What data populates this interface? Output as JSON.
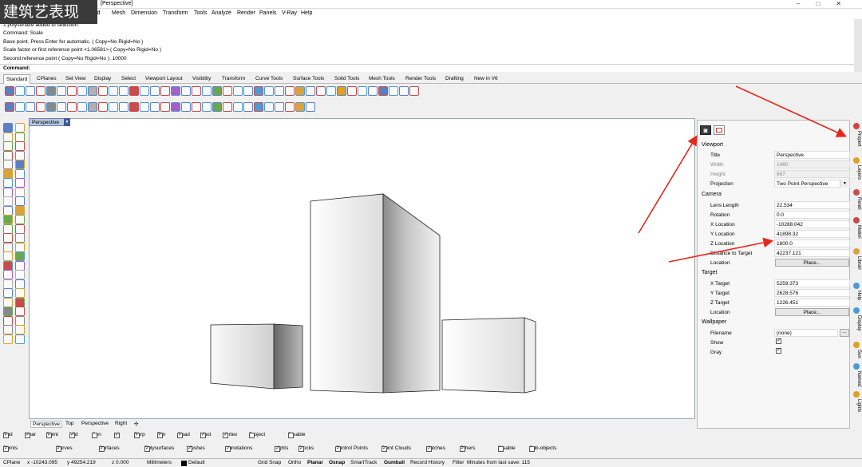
{
  "watermark": "建筑艺表现",
  "window": {
    "title": "[Perspective]"
  },
  "menu": [
    "id",
    "Mesh",
    "Dimension",
    "Transform",
    "Tools",
    "Analyze",
    "Render",
    "Panels",
    "V-Ray",
    "Help"
  ],
  "command_history": [
    "1 polysurface added to selection.",
    "Command: Scale",
    "Base point. Press Enter for automatic. ( Copy=No  Rigid=No )",
    "Scale factor or first reference point <1.06581> ( Copy=No  Rigid=No )",
    "Second reference point ( Copy=No  Rigid=No ): 10000"
  ],
  "command_prompt": "Command:",
  "toolbar_tabs": [
    "Standard",
    "CPlanes",
    "Set View",
    "Display",
    "Select",
    "Viewport Layout",
    "Visibility",
    "Transform",
    "Curve Tools",
    "Surface Tools",
    "Solid Tools",
    "Mesh Tools",
    "Render Tools",
    "Drafting",
    "New in V6"
  ],
  "viewport": {
    "label": "Perspective"
  },
  "viewport_tabs": [
    "Perspective",
    "Top",
    "Perspective",
    "Right"
  ],
  "osnaps": [
    {
      "label": "End",
      "on": true
    },
    {
      "label": "Near",
      "on": true
    },
    {
      "label": "Point",
      "on": true
    },
    {
      "label": "Mid",
      "on": true
    },
    {
      "label": "Cen",
      "on": false
    },
    {
      "label": "Int",
      "on": true
    },
    {
      "label": "Perp",
      "on": true
    },
    {
      "label": "Tan",
      "on": true
    },
    {
      "label": "Quad",
      "on": true
    },
    {
      "label": "Knot",
      "on": true
    },
    {
      "label": "Vertex",
      "on": true
    },
    {
      "label": "Project",
      "on": false
    },
    {
      "label": "Disable",
      "on": false
    }
  ],
  "filters": [
    {
      "label": "Points",
      "on": true
    },
    {
      "label": "Curves",
      "on": true
    },
    {
      "label": "Surfaces",
      "on": true
    },
    {
      "label": "Polysurfaces",
      "on": true
    },
    {
      "label": "Meshes",
      "on": true
    },
    {
      "label": "Annotations",
      "on": true
    },
    {
      "label": "Lights",
      "on": true
    },
    {
      "label": "Blocks",
      "on": true
    },
    {
      "label": "Control Points",
      "on": true
    },
    {
      "label": "Point Clouds",
      "on": true
    },
    {
      "label": "Hatches",
      "on": true
    },
    {
      "label": "Others",
      "on": true
    },
    {
      "label": "Disable",
      "on": false
    },
    {
      "label": "Sub-objects",
      "on": false
    }
  ],
  "status": {
    "cplane": "CPlane",
    "x": "x -10243.095",
    "y": "y 49254.219",
    "z": "z 0.000",
    "units": "Millimeters",
    "layer": "Default",
    "grid_snap": "Grid Snap",
    "ortho": "Ortho",
    "planar": "Planar",
    "osnap": "Osnap",
    "smarttrack": "SmartTrack",
    "gumball": "Gumball",
    "record_history": "Record History",
    "filter": "Filter",
    "save_msg": "Minutes from last save: 115"
  },
  "properties": {
    "viewport_header": "Viewport",
    "title_label": "Title",
    "title_value": "Perspective",
    "width_label": "Width",
    "width_value": "1480",
    "height_label": "Height",
    "height_value": "667",
    "projection_label": "Projection",
    "projection_value": "Two Point Perspective",
    "camera_header": "Camera",
    "lens_label": "Lens Length",
    "lens_value": "22.534",
    "rotation_label": "Rotation",
    "rotation_value": "0.0",
    "xloc_label": "X Location",
    "xloc_value": "-10288.042",
    "yloc_label": "Y Location",
    "yloc_value": "41898.32",
    "zloc_label": "Z Location",
    "zloc_value": "1600.0",
    "dist_label": "Distance to Target",
    "dist_value": "42237.121",
    "location_label": "Location",
    "place_label": "Place...",
    "target_header": "Target",
    "xt_label": "X Target",
    "xt_value": "5259.373",
    "yt_label": "Y Target",
    "yt_value": "2628.576",
    "zt_label": "Z Target",
    "zt_value": "1226.451",
    "tloc_label": "Location",
    "tplace_label": "Place...",
    "wallpaper_header": "Wallpaper",
    "filename_label": "Filename",
    "filename_value": "(none)",
    "browse_label": "...",
    "show_label": "Show",
    "gray_label": "Gray"
  },
  "panel_tabs": [
    "Propert",
    "Layers",
    "Rendi",
    "Materi",
    "Librari",
    "Help",
    "Display",
    "Sun",
    "Named",
    "Lights"
  ],
  "colors": {
    "arrow": "#e8261d",
    "viewport_tab": "#b8c8e4",
    "accent": "#3d5a99"
  }
}
